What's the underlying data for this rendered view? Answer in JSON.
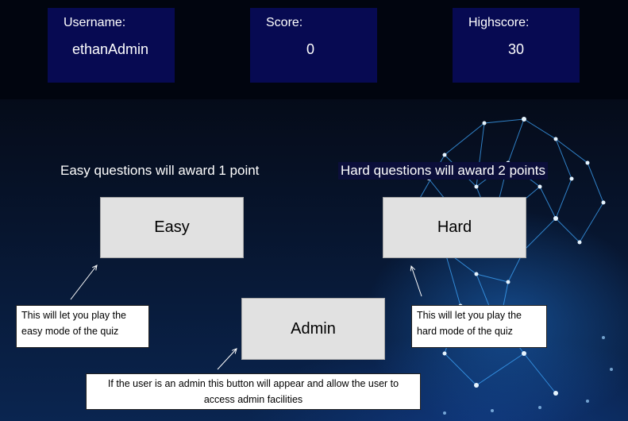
{
  "stats": {
    "username": {
      "label": "Username:",
      "value": "ethanAdmin"
    },
    "score": {
      "label": "Score:",
      "value": "0"
    },
    "highscore": {
      "label": "Highscore:",
      "value": "30"
    }
  },
  "modes": {
    "easy": {
      "caption": "Easy questions will award 1 point",
      "button_label": "Easy",
      "note_line1": "This will let you play the",
      "note_line2": "easy mode of the quiz"
    },
    "hard": {
      "caption": "Hard questions will award 2 points",
      "button_label": "Hard",
      "note_line1": "This will let you play the",
      "note_line2": "hard mode of the quiz"
    },
    "admin": {
      "button_label": "Admin",
      "note_line1": "If the user is an admin this button will appear and allow the user to",
      "note_line2": "access admin facilities"
    }
  },
  "colors": {
    "stat_box_bg": "#070a52",
    "button_bg": "#e1e1e1",
    "page_bg": "#01050f"
  },
  "icons": [
    "arrow-pointer-icon"
  ]
}
